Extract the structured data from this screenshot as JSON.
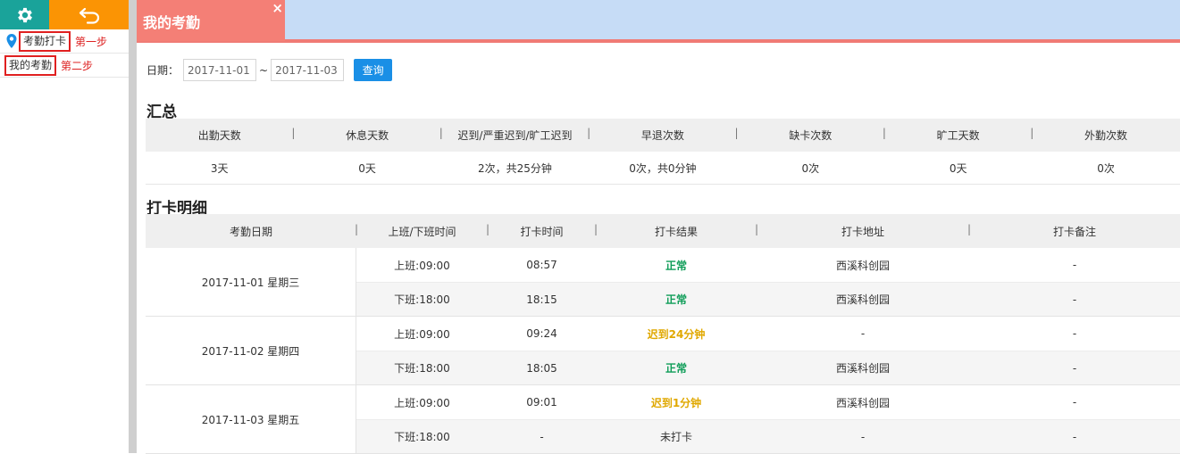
{
  "sidebar": {
    "settings_icon": "gear-icon",
    "back_icon": "undo-arrow-icon",
    "location_icon": "map-pin-icon",
    "punch_label": "考勤打卡",
    "punch_step": "第一步",
    "mine_label": "我的考勤",
    "mine_step": "第二步"
  },
  "tab": {
    "title": "我的考勤",
    "close": "×"
  },
  "filter": {
    "label": "日期：",
    "start": "2017-11-01",
    "sep": "~",
    "end": "2017-11-03",
    "button": "查询"
  },
  "summary": {
    "title": "汇总",
    "headers": [
      "出勤天数",
      "休息天数",
      "迟到/严重迟到/旷工迟到",
      "早退次数",
      "缺卡次数",
      "旷工天数",
      "外勤次数"
    ],
    "values": [
      "3天",
      "0天",
      "2次，共25分钟",
      "0次，共0分钟",
      "0次",
      "0天",
      "0次"
    ]
  },
  "detail": {
    "title": "打卡明细",
    "headers": [
      "考勤日期",
      "上班/下班时间",
      "打卡时间",
      "打卡结果",
      "打卡地址",
      "打卡备注"
    ],
    "days": [
      {
        "date": "2017-11-01 星期三",
        "rows": [
          {
            "shift": "上班:09:00",
            "punch": "08:57",
            "result": "正常",
            "addr": "西溪科创园",
            "note": "-"
          },
          {
            "shift": "下班:18:00",
            "punch": "18:15",
            "result": "正常",
            "addr": "西溪科创园",
            "note": "-"
          }
        ]
      },
      {
        "date": "2017-11-02 星期四",
        "rows": [
          {
            "shift": "上班:09:00",
            "punch": "09:24",
            "result": "迟到24分钟",
            "addr": "-",
            "note": "-"
          },
          {
            "shift": "下班:18:00",
            "punch": "18:05",
            "result": "正常",
            "addr": "西溪科创园",
            "note": "-"
          }
        ]
      },
      {
        "date": "2017-11-03 星期五",
        "rows": [
          {
            "shift": "上班:09:00",
            "punch": "09:01",
            "result": "迟到1分钟",
            "addr": "西溪科创园",
            "note": "-"
          },
          {
            "shift": "下班:18:00",
            "punch": "-",
            "result": "未打卡",
            "addr": "-",
            "note": "-"
          }
        ]
      }
    ]
  },
  "colors": {
    "teal": "#1aa39a",
    "orange": "#fb9404",
    "tab": "#f47f76",
    "topbar": "#c6dcf6",
    "ok": "#0f9d58",
    "late": "#e0a800",
    "button": "#1a8fe6"
  }
}
